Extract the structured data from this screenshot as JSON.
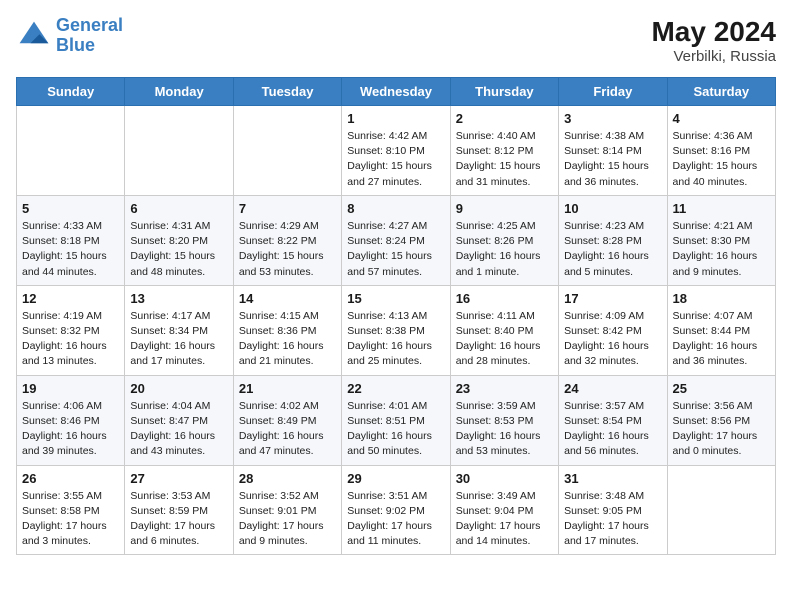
{
  "header": {
    "logo_line1": "General",
    "logo_line2": "Blue",
    "month_year": "May 2024",
    "location": "Verbilki, Russia"
  },
  "days_of_week": [
    "Sunday",
    "Monday",
    "Tuesday",
    "Wednesday",
    "Thursday",
    "Friday",
    "Saturday"
  ],
  "weeks": [
    [
      {
        "day": "",
        "info": ""
      },
      {
        "day": "",
        "info": ""
      },
      {
        "day": "",
        "info": ""
      },
      {
        "day": "1",
        "info": "Sunrise: 4:42 AM\nSunset: 8:10 PM\nDaylight: 15 hours\nand 27 minutes."
      },
      {
        "day": "2",
        "info": "Sunrise: 4:40 AM\nSunset: 8:12 PM\nDaylight: 15 hours\nand 31 minutes."
      },
      {
        "day": "3",
        "info": "Sunrise: 4:38 AM\nSunset: 8:14 PM\nDaylight: 15 hours\nand 36 minutes."
      },
      {
        "day": "4",
        "info": "Sunrise: 4:36 AM\nSunset: 8:16 PM\nDaylight: 15 hours\nand 40 minutes."
      }
    ],
    [
      {
        "day": "5",
        "info": "Sunrise: 4:33 AM\nSunset: 8:18 PM\nDaylight: 15 hours\nand 44 minutes."
      },
      {
        "day": "6",
        "info": "Sunrise: 4:31 AM\nSunset: 8:20 PM\nDaylight: 15 hours\nand 48 minutes."
      },
      {
        "day": "7",
        "info": "Sunrise: 4:29 AM\nSunset: 8:22 PM\nDaylight: 15 hours\nand 53 minutes."
      },
      {
        "day": "8",
        "info": "Sunrise: 4:27 AM\nSunset: 8:24 PM\nDaylight: 15 hours\nand 57 minutes."
      },
      {
        "day": "9",
        "info": "Sunrise: 4:25 AM\nSunset: 8:26 PM\nDaylight: 16 hours\nand 1 minute."
      },
      {
        "day": "10",
        "info": "Sunrise: 4:23 AM\nSunset: 8:28 PM\nDaylight: 16 hours\nand 5 minutes."
      },
      {
        "day": "11",
        "info": "Sunrise: 4:21 AM\nSunset: 8:30 PM\nDaylight: 16 hours\nand 9 minutes."
      }
    ],
    [
      {
        "day": "12",
        "info": "Sunrise: 4:19 AM\nSunset: 8:32 PM\nDaylight: 16 hours\nand 13 minutes."
      },
      {
        "day": "13",
        "info": "Sunrise: 4:17 AM\nSunset: 8:34 PM\nDaylight: 16 hours\nand 17 minutes."
      },
      {
        "day": "14",
        "info": "Sunrise: 4:15 AM\nSunset: 8:36 PM\nDaylight: 16 hours\nand 21 minutes."
      },
      {
        "day": "15",
        "info": "Sunrise: 4:13 AM\nSunset: 8:38 PM\nDaylight: 16 hours\nand 25 minutes."
      },
      {
        "day": "16",
        "info": "Sunrise: 4:11 AM\nSunset: 8:40 PM\nDaylight: 16 hours\nand 28 minutes."
      },
      {
        "day": "17",
        "info": "Sunrise: 4:09 AM\nSunset: 8:42 PM\nDaylight: 16 hours\nand 32 minutes."
      },
      {
        "day": "18",
        "info": "Sunrise: 4:07 AM\nSunset: 8:44 PM\nDaylight: 16 hours\nand 36 minutes."
      }
    ],
    [
      {
        "day": "19",
        "info": "Sunrise: 4:06 AM\nSunset: 8:46 PM\nDaylight: 16 hours\nand 39 minutes."
      },
      {
        "day": "20",
        "info": "Sunrise: 4:04 AM\nSunset: 8:47 PM\nDaylight: 16 hours\nand 43 minutes."
      },
      {
        "day": "21",
        "info": "Sunrise: 4:02 AM\nSunset: 8:49 PM\nDaylight: 16 hours\nand 47 minutes."
      },
      {
        "day": "22",
        "info": "Sunrise: 4:01 AM\nSunset: 8:51 PM\nDaylight: 16 hours\nand 50 minutes."
      },
      {
        "day": "23",
        "info": "Sunrise: 3:59 AM\nSunset: 8:53 PM\nDaylight: 16 hours\nand 53 minutes."
      },
      {
        "day": "24",
        "info": "Sunrise: 3:57 AM\nSunset: 8:54 PM\nDaylight: 16 hours\nand 56 minutes."
      },
      {
        "day": "25",
        "info": "Sunrise: 3:56 AM\nSunset: 8:56 PM\nDaylight: 17 hours\nand 0 minutes."
      }
    ],
    [
      {
        "day": "26",
        "info": "Sunrise: 3:55 AM\nSunset: 8:58 PM\nDaylight: 17 hours\nand 3 minutes."
      },
      {
        "day": "27",
        "info": "Sunrise: 3:53 AM\nSunset: 8:59 PM\nDaylight: 17 hours\nand 6 minutes."
      },
      {
        "day": "28",
        "info": "Sunrise: 3:52 AM\nSunset: 9:01 PM\nDaylight: 17 hours\nand 9 minutes."
      },
      {
        "day": "29",
        "info": "Sunrise: 3:51 AM\nSunset: 9:02 PM\nDaylight: 17 hours\nand 11 minutes."
      },
      {
        "day": "30",
        "info": "Sunrise: 3:49 AM\nSunset: 9:04 PM\nDaylight: 17 hours\nand 14 minutes."
      },
      {
        "day": "31",
        "info": "Sunrise: 3:48 AM\nSunset: 9:05 PM\nDaylight: 17 hours\nand 17 minutes."
      },
      {
        "day": "",
        "info": ""
      }
    ]
  ]
}
